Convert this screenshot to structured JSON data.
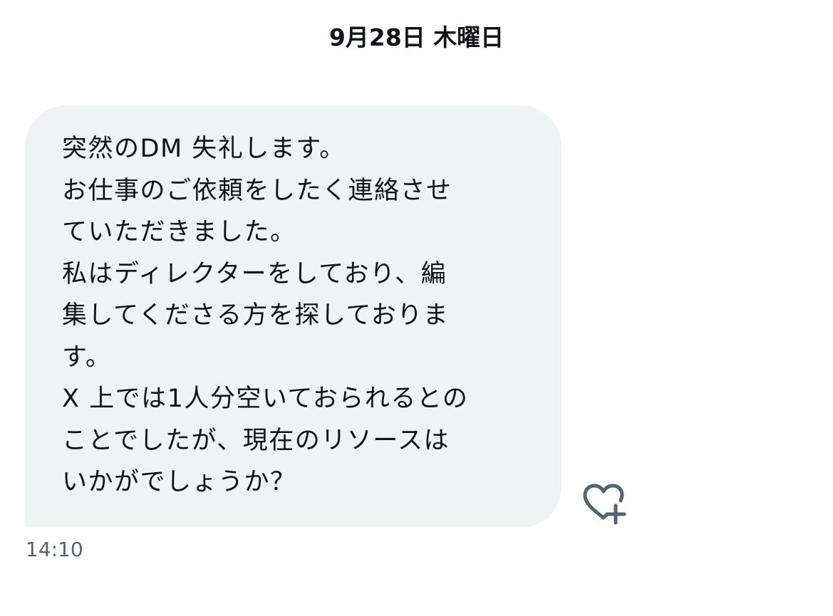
{
  "conversation": {
    "date_divider": "9月28日 木曜日"
  },
  "message": {
    "lines": [
      "突然のDM 失礼します。",
      "お仕事のご依頼をしたく連絡させ",
      "ていただきました。",
      "私はディレクターをしており、編",
      "集してくださる方を探しておりま",
      "す。",
      "X 上では1人分空いておられるとの",
      "ことでしたが、現在のリソースは",
      "いかがでしょうか？"
    ],
    "timestamp": "14:10",
    "reaction_icon": "heart-plus-icon"
  },
  "colors": {
    "bubble_background": "#eff3f4",
    "text_primary": "#0f1419",
    "text_secondary": "#536471",
    "icon": "#536471"
  }
}
